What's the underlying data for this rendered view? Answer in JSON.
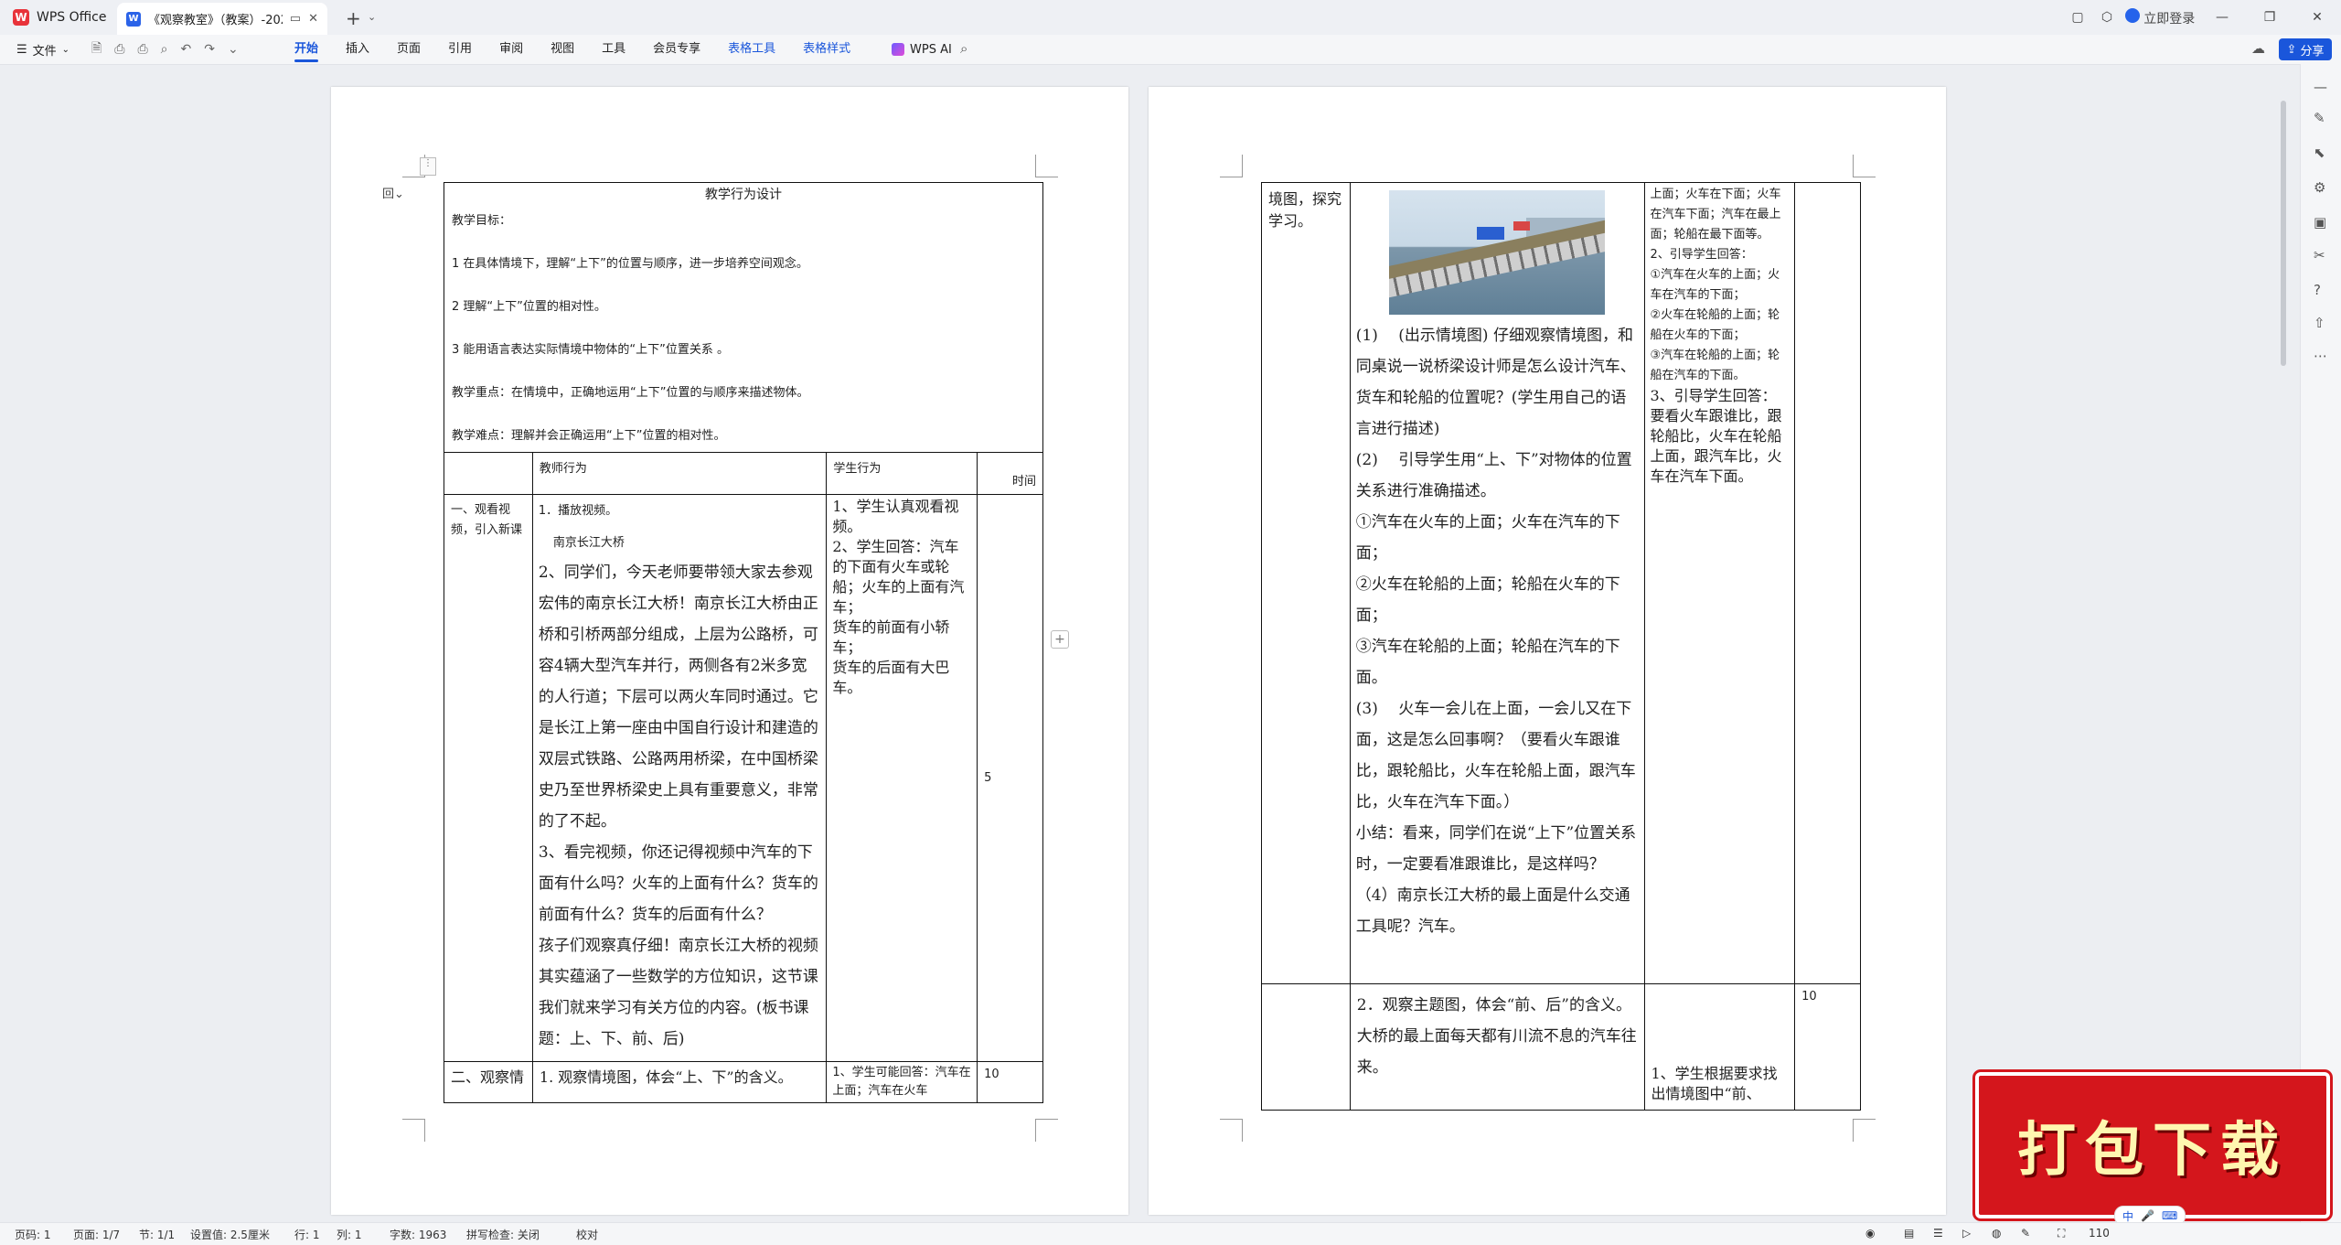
{
  "app": {
    "name": "WPS Office",
    "doc_tab": "《观察教室》（教案）-2024...",
    "login": "立即登录",
    "share": "分享"
  },
  "toolbar": {
    "file": "文件",
    "tabs": [
      "开始",
      "插入",
      "页面",
      "引用",
      "审阅",
      "视图",
      "工具",
      "会员专享",
      "表格工具",
      "表格样式"
    ],
    "wps_ai": "WPS AI"
  },
  "page1": {
    "title": "教学行为设计",
    "objectives_title": "教学目标：",
    "objectives": [
      "1 在具体情境下，理解“上下”的位置与顺序，进一步培养空间观念。",
      "2 理解“上下”位置的相对性。",
      "3 能用语言表达实际情境中物体的“上下”位置关系 。"
    ],
    "key_point": "教学重点：在情境中，正确地运用“上下”位置的与顺序来描述物体。",
    "difficulty": "教学难点：理解并会正确运用“上下”位置的相对性。",
    "headers": {
      "teacher": "教师行为",
      "student": "学生行为",
      "time": "时间"
    },
    "row1": {
      "stage": "一、观看视频，引入新课",
      "teacher_small": [
        "1．播放视频。",
        "南京长江大桥"
      ],
      "teacher_serif": [
        "2、同学们，今天老师要带领大家去参观宏伟的南京长江大桥！南京长江大桥由正桥和引桥两部分组成，上层为公路桥，可容4辆大型汽车并行，两侧各有2米多宽的人行道；下层可以两火车同时通过。它是长江上第一座由中国自行设计和建造的双层式铁路、公路两用桥梁，在中国桥梁史乃至世界桥梁史上具有重要意义，非常的了不起。",
        "3、看完视频，你还记得视频中汽车的下面有什么吗？火车的上面有什么？货车的前面有什么？货车的后面有什么？",
        "孩子们观察真仔细！南京长江大桥的视频其实蕴涵了一些数学的方位知识，这节课我们就来学习有关方位的内容。(板书课题：上、下、前、后)"
      ],
      "student": [
        "1、学生认真观看视频。",
        "2、学生回答：汽车的下面有火车或轮船；火车的上面有汽车；",
        "货车的前面有小轿车；",
        "货车的后面有大巴车。"
      ],
      "time": "5"
    },
    "row2": {
      "stage": "二、观察情",
      "teacher": "1. 观察情境图，体会“上、下”的含义。",
      "student": "1、学生可能回答：汽车在上面；汽车在火车",
      "time": "10"
    }
  },
  "page2": {
    "row1": {
      "stage": "境图，探究学习。",
      "teacher": [
        "(1)　 (出示情境图) 仔细观察情境图，和同桌说一说桥梁设计师是怎么设计汽车、货车和轮船的位置呢？(学生用自己的语言进行描述)",
        "(2)　 引导学生用“上、下”对物体的位置关系进行准确描述。",
        "①汽车在火车的上面；火车在汽车的下面；",
        "②火车在轮船的上面；轮船在火车的下面；",
        "③汽车在轮船的上面；轮船在汽车的下面。",
        "(3)　 火车一会儿在上面，一会儿又在下面，这是怎么回事啊？（要看火车跟谁比，跟轮船比，火车在轮船上面，跟汽车比，火车在汽车下面。）",
        "小结：看来，同学们在说“上下”位置关系时，一定要看准跟谁比，是这样吗？",
        "（4）南京长江大桥的最上面是什么交通工具呢？汽车。"
      ],
      "student_small": [
        "上面；火车在下面；火车在汽车下面；汽车在最上面；轮船在最下面等。",
        "2、引导学生回答：",
        "①汽车在火车的上面；火车在汽车的下面；",
        "②火车在轮船的上面；轮船在火车的下面；",
        "③汽车在轮船的上面；轮船在汽车的下面。"
      ],
      "student_serif": "3、引导学生回答：要看火车跟谁比，跟轮船比，火车在轮船上面，跟汽车比，火车在汽车下面。"
    },
    "row2": {
      "teacher": "2．观察主题图，体会“前、后”的含义。大桥的最上面每天都有川流不息的汽车往来。",
      "student": "1、学生根据要求找出情境图中“前、",
      "time": "10"
    }
  },
  "status": {
    "page": "页码: 1",
    "pages": "页面: 1/7",
    "section": "节: 1/1",
    "setting": "设置值: 2.5厘米",
    "row": "行: 1",
    "col": "列: 1",
    "words": "字数: 1963",
    "spell": "拼写检查: 关闭",
    "proof": "校对",
    "zoom": "110"
  },
  "badge": {
    "text": "打包下载"
  },
  "ime": {
    "text": "中"
  }
}
